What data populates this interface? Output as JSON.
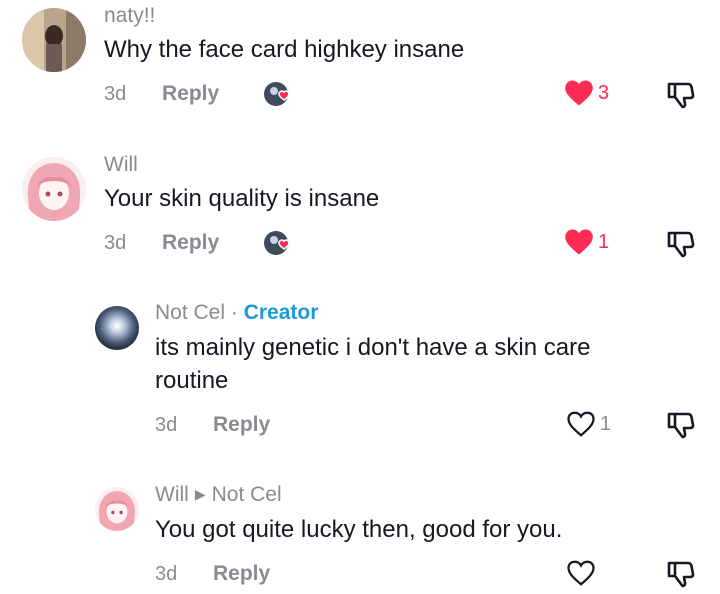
{
  "comments": [
    {
      "username": "naty!!",
      "text": "Why the face card highkey insane",
      "time": "3d",
      "reply_label": "Reply",
      "likes": "3",
      "liked": true
    },
    {
      "username": "Will",
      "text": "Your skin quality is insane",
      "time": "3d",
      "reply_label": "Reply",
      "likes": "1",
      "liked": true
    },
    {
      "username": "Not Cel",
      "separator": " · ",
      "badge": "Creator",
      "text_line1": "its mainly genetic i don't have a skin care",
      "text_line2": "routine",
      "time": "3d",
      "reply_label": "Reply",
      "likes": "1",
      "liked": false
    },
    {
      "username": "Will",
      "reply_to": "Not Cel",
      "text": "You got quite lucky then, good for you.",
      "time": "3d",
      "reply_label": "Reply",
      "likes": "",
      "liked": false
    }
  ],
  "colors": {
    "like_red": "#fe2c55",
    "creator_blue": "#1a9bd7",
    "secondary_grey": "#8a8b91"
  },
  "icons": [
    "heart-icon",
    "heart-outline-icon",
    "dislike-icon",
    "creator-liked-icon"
  ]
}
